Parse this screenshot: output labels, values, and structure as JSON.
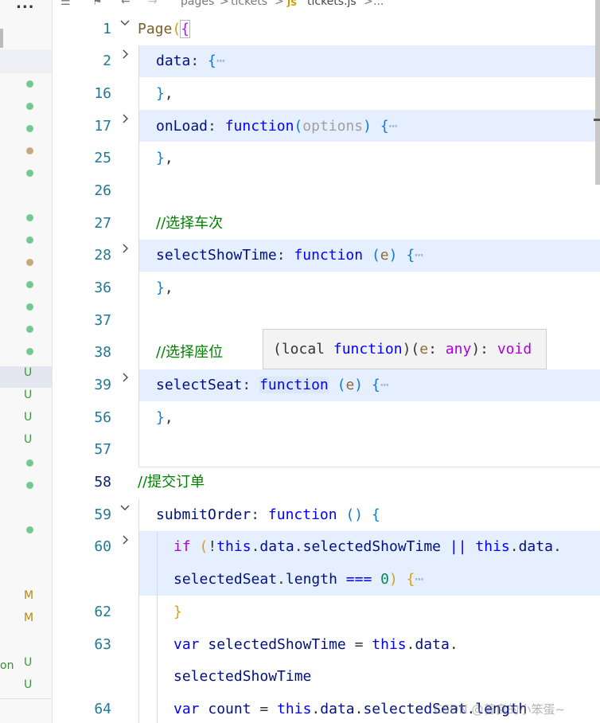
{
  "sidebar": {
    "more": "...",
    "items": [
      {
        "status": "dot",
        "color": "#73c991"
      },
      {
        "status": "dot",
        "color": "#73c991"
      },
      {
        "status": "dot",
        "color": "#73c991"
      },
      {
        "status": "dot",
        "color": "#c9a97a"
      },
      {
        "status": "dot",
        "color": "#73c991"
      },
      {
        "status": "dot",
        "color": "#73c991"
      },
      {
        "status": "dot",
        "color": "#73c991"
      },
      {
        "status": "dot",
        "color": "#c9a97a"
      },
      {
        "status": "dot",
        "color": "#73c991"
      },
      {
        "status": "dot",
        "color": "#73c991"
      },
      {
        "status": "dot",
        "color": "#73c991"
      },
      {
        "status": "dot",
        "color": "#73c991"
      },
      {
        "status": "U",
        "color": "#3a9a3a"
      },
      {
        "status": "U",
        "color": "#3a9a3a"
      },
      {
        "status": "U",
        "color": "#3a9a3a"
      },
      {
        "status": "U",
        "color": "#3a9a3a"
      },
      {
        "status": "dot",
        "color": "#73c991"
      },
      {
        "status": "dot",
        "color": "#73c991"
      },
      {
        "status": "dot",
        "color": "#73c991"
      },
      {
        "status": "M",
        "color": "#b8860b"
      },
      {
        "status": "M",
        "color": "#b8860b"
      },
      {
        "status": "U",
        "color": "#3a9a3a"
      },
      {
        "status": "U",
        "color": "#3a9a3a"
      }
    ],
    "fragment_text": "on"
  },
  "breadcrumb": {
    "seg1": "pages",
    "sep1": ">",
    "seg2": "tickets",
    "sep2": ">",
    "file_badge": "JS",
    "file": "tickets.js",
    "sep3": ">",
    "more": "..."
  },
  "lines": {
    "l1": "1",
    "l2": "2",
    "l16": "16",
    "l17": "17",
    "l25": "25",
    "l26": "26",
    "l27": "27",
    "l28": "28",
    "l36": "36",
    "l37": "37",
    "l38": "38",
    "l39": "39",
    "l56": "56",
    "l57": "57",
    "l58": "58",
    "l59": "59",
    "l60": "60",
    "l62": "62",
    "l63": "63",
    "l64": "64"
  },
  "code": {
    "comment_select_train": "//选择车次",
    "comment_select_seat": "//选择座位",
    "comment_submit": "//提交订单",
    "fn_select_show_time": "selectShowTime",
    "fn_select_seat": "selectSeat",
    "fn_submit": "submitOrder",
    "kw_function": "function",
    "param_options": "options",
    "param_e": "e",
    "data_key": "data",
    "onload_key": "onLoad",
    "page_call": "Page"
  },
  "tooltip": {
    "text_local": "(local",
    "text_function": "function",
    "text_rest1": ")(",
    "text_e": "e",
    "text_colon": ": ",
    "text_any": "any",
    "text_rest2": "): ",
    "text_void": "void"
  },
  "watermark": "CSDN @善良的小笨蛋~",
  "colors": {
    "accent_blue": "#0000ff",
    "comment_green": "#008000",
    "line_highlight": "#e5efff"
  }
}
